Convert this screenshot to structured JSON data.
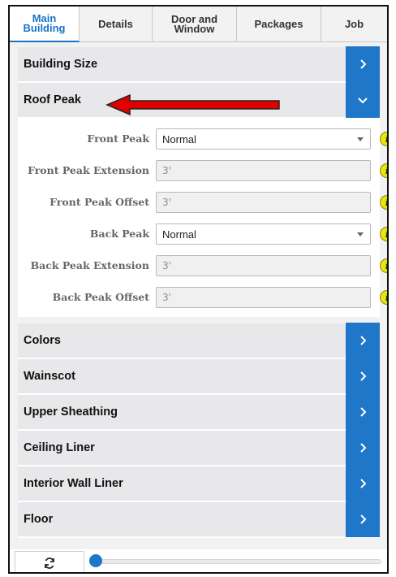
{
  "tabs": [
    {
      "label": "Main Building",
      "active": true
    },
    {
      "label": "Details",
      "active": false
    },
    {
      "label": "Door and Window",
      "active": false
    },
    {
      "label": "Packages",
      "active": false
    },
    {
      "label": "Job",
      "active": false
    }
  ],
  "sections": {
    "building_size": "Building Size",
    "roof_peak": "Roof Peak",
    "colors": "Colors",
    "wainscot": "Wainscot",
    "upper_sheathing": "Upper Sheathing",
    "ceiling_liner": "Ceiling Liner",
    "interior_wall_liner": "Interior Wall Liner",
    "floor": "Floor"
  },
  "roof_peak_fields": {
    "front_peak": {
      "label": "Front Peak",
      "value": "Normal"
    },
    "front_peak_extension": {
      "label": "Front Peak Extension",
      "value": "3'"
    },
    "front_peak_offset": {
      "label": "Front Peak Offset",
      "value": "3'"
    },
    "back_peak": {
      "label": "Back Peak",
      "value": "Normal"
    },
    "back_peak_extension": {
      "label": "Back Peak Extension",
      "value": "3'"
    },
    "back_peak_offset": {
      "label": "Back Peak Offset",
      "value": "3'"
    }
  },
  "info_icon_glyph": "i",
  "slider": {
    "value": 0
  },
  "colors": {
    "accent": "#1f77c9",
    "info": "#e9e60b",
    "arrow": "#e00000"
  },
  "icons": {
    "expand": "chevron-right-icon",
    "collapse": "chevron-down-icon",
    "refresh": "refresh-icon",
    "info": "info-icon"
  }
}
